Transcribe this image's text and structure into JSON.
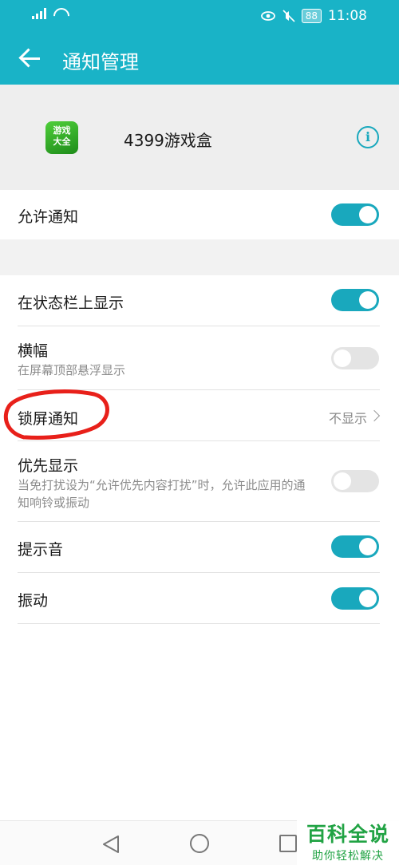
{
  "status_bar": {
    "time": "11:08",
    "battery": "88"
  },
  "app_bar": {
    "title": "通知管理"
  },
  "app_header": {
    "app_name": "4399游戏盒",
    "icon_text_line1": "游戏",
    "icon_text_line2": "大全",
    "info_symbol": "i"
  },
  "settings": {
    "allow_notifications": {
      "label": "允许通知",
      "enabled": true
    },
    "status_bar_display": {
      "label": "在状态栏上显示",
      "enabled": true
    },
    "banner": {
      "label": "横幅",
      "subtitle": "在屏幕顶部悬浮显示",
      "enabled": false
    },
    "lock_screen": {
      "label": "锁屏通知",
      "value": "不显示"
    },
    "priority": {
      "label": "优先显示",
      "subtitle": "当免打扰设为“允许优先内容打扰”时，允许此应用的通知响铃或振动",
      "enabled": false
    },
    "sound": {
      "label": "提示音",
      "enabled": true
    },
    "vibration": {
      "label": "振动",
      "enabled": true
    }
  },
  "watermark": {
    "title": "百科全说",
    "subtitle": "助你轻松解决"
  },
  "colors": {
    "accent": "#19b3c7",
    "toggle_on": "#19a8bd",
    "annotation": "#e8201a",
    "watermark": "#21a344"
  }
}
